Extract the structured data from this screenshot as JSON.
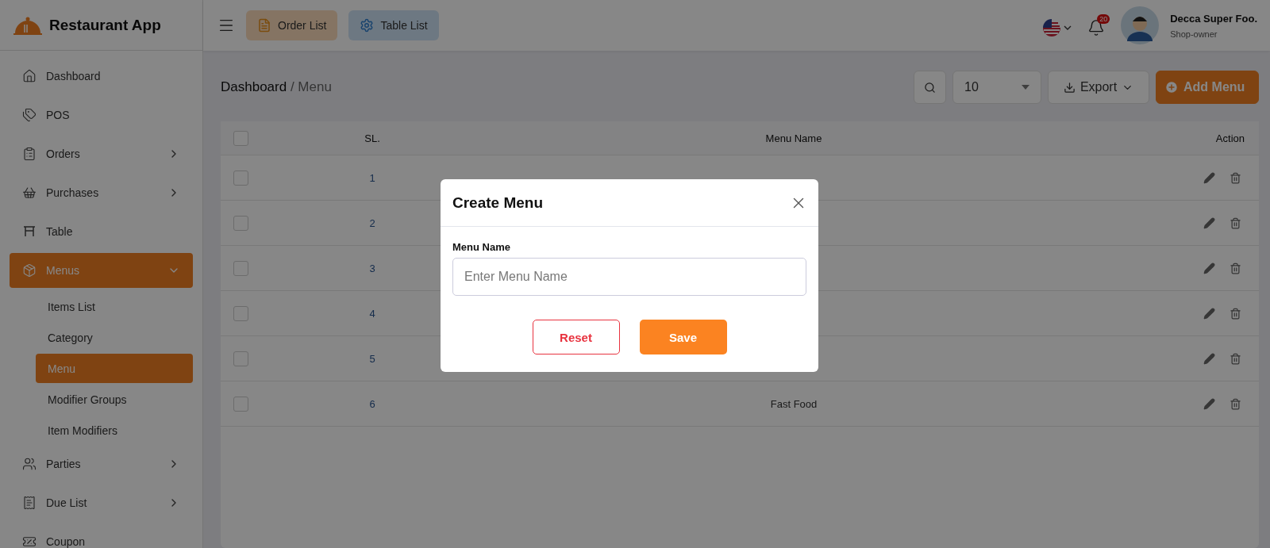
{
  "brand": {
    "name": "Restaurant App"
  },
  "header": {
    "quick_links": [
      {
        "label": "Order List",
        "kind": "order"
      },
      {
        "label": "Table List",
        "kind": "table"
      }
    ],
    "notifications": {
      "count": "20"
    },
    "user": {
      "name": "Decca Super Foo.",
      "role": "Shop-owner"
    }
  },
  "sidebar": {
    "items": [
      {
        "label": "Dashboard",
        "selected": false
      },
      {
        "label": "POS",
        "selected": false
      },
      {
        "label": "Orders",
        "selected": false,
        "expanded": false
      },
      {
        "label": "Purchases",
        "selected": false,
        "expanded": false
      },
      {
        "label": "Table",
        "selected": false
      },
      {
        "label": "Menus",
        "selected": true,
        "expanded": true,
        "children": [
          {
            "label": "Items List",
            "selected": false
          },
          {
            "label": "Category",
            "selected": false
          },
          {
            "label": "Menu",
            "selected": true
          },
          {
            "label": "Modifier Groups",
            "selected": false
          },
          {
            "label": "Item Modifiers",
            "selected": false
          }
        ]
      },
      {
        "label": "Parties",
        "selected": false,
        "expanded": false
      },
      {
        "label": "Due List",
        "selected": false,
        "expanded": false
      },
      {
        "label": "Coupon",
        "selected": false
      }
    ]
  },
  "breadcrumb": {
    "parent": "Dashboard",
    "current": "/ Menu"
  },
  "toolbar": {
    "page_size": "10",
    "export": "Export",
    "add": "Add Menu"
  },
  "table": {
    "columns": [
      "SL.",
      "Menu Name",
      "Action"
    ],
    "header_checked": false,
    "rows": [
      {
        "sl": "1",
        "checked": false
      },
      {
        "sl": "2",
        "checked": false
      },
      {
        "sl": "3",
        "checked": false
      },
      {
        "sl": "4",
        "checked": false
      },
      {
        "sl": "5",
        "checked": false
      },
      {
        "sl": "6",
        "name": "Fast Food",
        "checked": false
      }
    ]
  },
  "modal": {
    "title": "Create Menu",
    "field": {
      "label": "Menu Name",
      "placeholder": "Enter Menu Name"
    },
    "buttons": [
      {
        "label": "Reset",
        "kind": "secondary"
      },
      {
        "label": "Save",
        "kind": "primary"
      }
    ]
  }
}
